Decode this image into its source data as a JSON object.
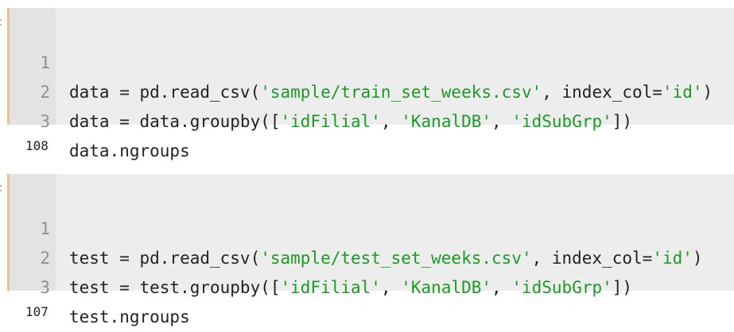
{
  "cells": [
    {
      "lines": [
        {
          "num": "1",
          "pre": "data = pd.read_csv(",
          "s1": "'sample/train_set_weeks.csv'",
          "mid": ", index_col=",
          "s2": "'id'",
          "post": ")"
        },
        {
          "num": "2",
          "pre": "data = data.groupby([",
          "s1": "'idFilial'",
          "mid": ", ",
          "s2": "'KanalDB'",
          "mid2": ", ",
          "s3": "'idSubGrp'",
          "post": "])"
        },
        {
          "num": "3",
          "pre": "data.ngroups"
        }
      ],
      "output": "108"
    },
    {
      "lines": [
        {
          "num": "1",
          "pre": "test = pd.read_csv(",
          "s1": "'sample/test_set_weeks.csv'",
          "mid": ", index_col=",
          "s2": "'id'",
          "post": ")"
        },
        {
          "num": "2",
          "pre": "test = test.groupby([",
          "s1": "'idFilial'",
          "mid": ", ",
          "s2": "'KanalDB'",
          "mid2": ", ",
          "s3": "'idSubGrp'",
          "post": "])"
        },
        {
          "num": "3",
          "pre": "test.ngroups"
        }
      ],
      "output": "107"
    }
  ],
  "colors": {
    "string": "#1c9a25",
    "cell_accent": "#f0c08a",
    "cell_background": "#ededed",
    "gutter_background": "#e3e3e3"
  }
}
